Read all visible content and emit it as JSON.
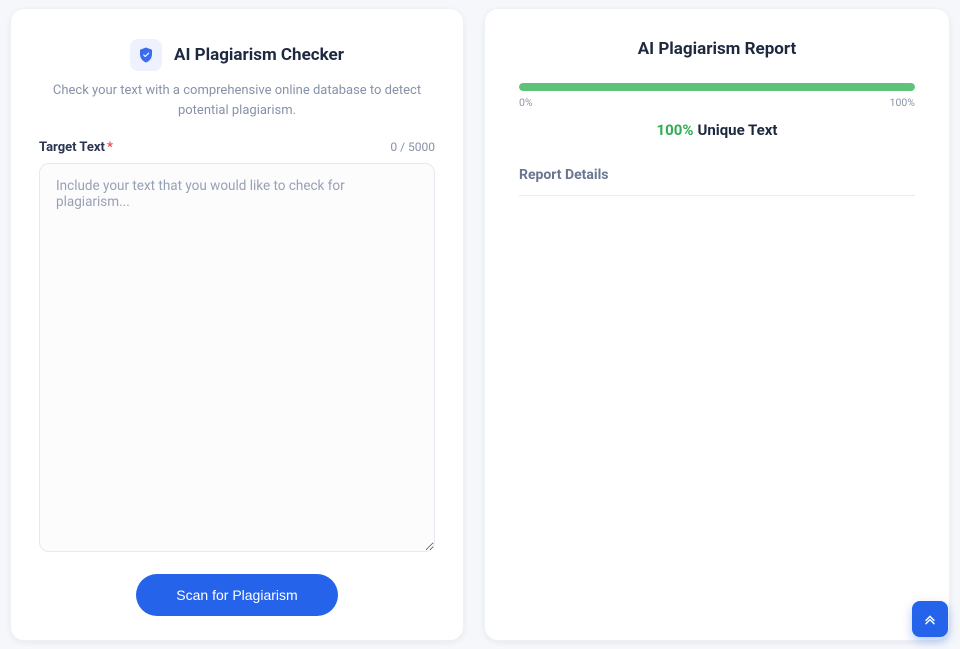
{
  "left": {
    "title": "AI Plagiarism Checker",
    "subtitle": "Check your text with a comprehensive online database to detect potential plagiarism.",
    "label": "Target Text",
    "required_mark": "*",
    "counter": "0 / 5000",
    "placeholder": "Include your text that you would like to check for plagiarism...",
    "button": "Scan for Plagiarism"
  },
  "right": {
    "title": "AI Plagiarism Report",
    "progress_min": "0%",
    "progress_max": "100%",
    "unique_pct": "100%",
    "unique_label": "Unique Text",
    "details_heading": "Report Details",
    "progress_value": 100
  }
}
